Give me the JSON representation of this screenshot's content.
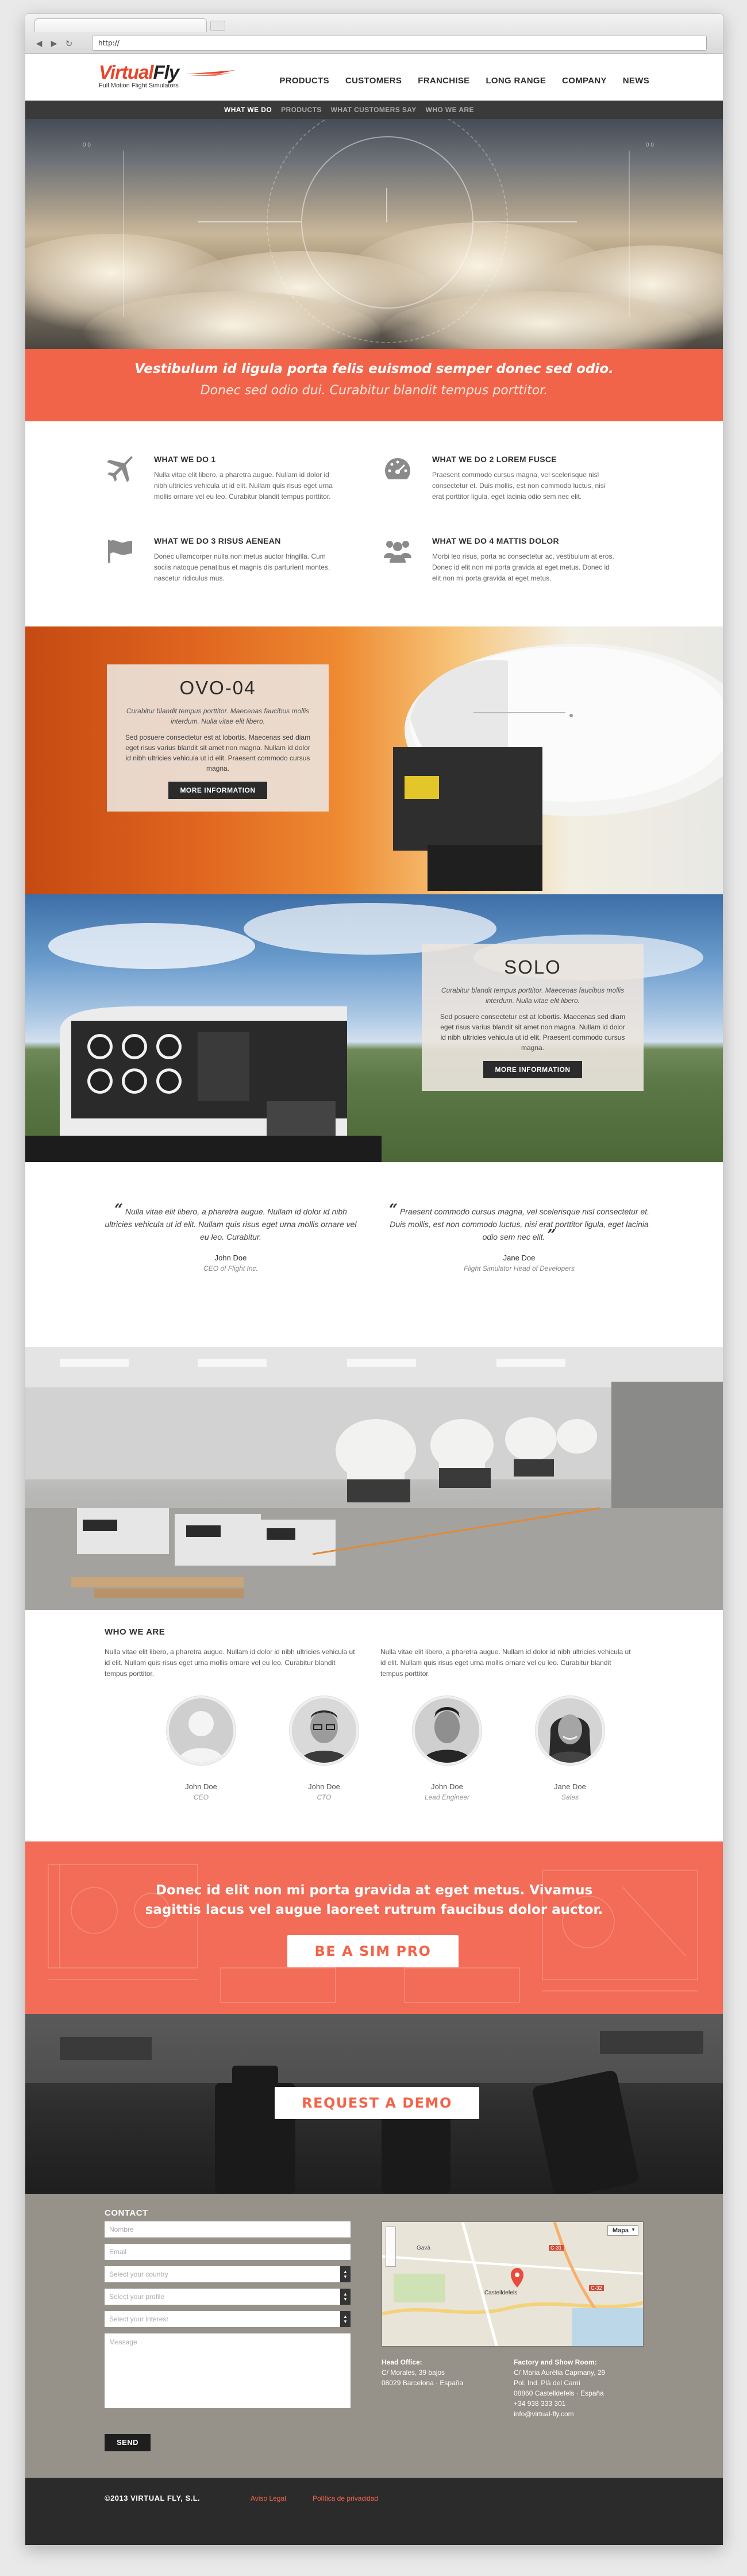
{
  "browser": {
    "url": "http://"
  },
  "brand": {
    "name_part1": "Virtual",
    "name_part2": "Fly",
    "tagline": "Full Motion Flight Simulators"
  },
  "nav": [
    "PRODUCTS",
    "CUSTOMERS",
    "FRANCHISE",
    "LONG RANGE",
    "COMPANY",
    "NEWS"
  ],
  "subnav": [
    {
      "label": "WHAT WE DO",
      "active": true
    },
    {
      "label": "PRODUCTS",
      "active": false
    },
    {
      "label": "WHAT CUSTOMERS SAY",
      "active": false
    },
    {
      "label": "WHO WE ARE",
      "active": false
    }
  ],
  "hero": {
    "headline": "Vestibulum id ligula porta felis euismod semper donec sed odio.",
    "subline": "Donec sed odio dui. Curabitur blandit tempus porttitor."
  },
  "what_we_do": [
    {
      "icon": "airplane-icon",
      "title": "WHAT WE DO 1",
      "text": "Nulla vitae elit libero, a pharetra augue. Nullam id dolor id nibh ultricies vehicula ut id elit. Nullam quis risus eget urna mollis ornare vel eu leo. Curabitur blandit tempus porttitor."
    },
    {
      "icon": "gauge-icon",
      "title": "WHAT WE DO 2 LOREM FUSCE",
      "text": "Praesent commodo cursus magna, vel scelerisque nisl consectetur et. Duis mollis, est non commodo luctus, nisi erat porttitor ligula, eget lacinia odio sem nec elit."
    },
    {
      "icon": "flag-icon",
      "title": "WHAT WE DO 3 RISUS AENEAN",
      "text": "Donec ullamcorper nulla non metus auctor fringilla. Cum sociis natoque penatibus et magnis dis parturient montes, nascetur ridiculus mus."
    },
    {
      "icon": "people-icon",
      "title": "WHAT WE DO 4 MATTIS DOLOR",
      "text": "Morbi leo risus, porta ac consectetur ac, vestibulum at eros. Donec id elit non mi porta gravida at eget metus. Donec id elit non mi porta gravida at eget metus."
    }
  ],
  "products": {
    "ovo": {
      "title": "OVO-04",
      "quote": "Curabitur blandit tempus porttitor. Maecenas faucibus mollis interdum. Nulla vitae elit libero.",
      "text": "Sed posuere consectetur est at lobortis. Maecenas sed diam eget risus varius blandit sit amet non magna. Nullam id dolor id nibh ultricies vehicula ut id elit. Praesent commodo cursus magna.",
      "button": "MORE INFORMATION"
    },
    "solo": {
      "title": "SOLO",
      "quote": "Curabitur blandit tempus porttitor. Maecenas faucibus mollis interdum. Nulla vitae elit libero.",
      "text": "Sed posuere consectetur est at lobortis. Maecenas sed diam eget risus varius blandit sit amet non magna. Nullam id dolor id nibh ultricies vehicula ut id elit. Praesent commodo cursus magna.",
      "button": "MORE INFORMATION"
    }
  },
  "testimonials": [
    {
      "quote": "Nulla vitae elit libero, a pharetra augue. Nullam id dolor id nibh ultricies vehicula ut id elit. Nullam quis risus eget urna mollis ornare vel eu leo. Curabitur.",
      "name": "John Doe",
      "role": "CEO of Flight Inc."
    },
    {
      "quote": "Praesent commodo cursus magna, vel scelerisque nisl consectetur et. Duis mollis, est non commodo luctus, nisi erat porttitor ligula, eget lacinia odio sem nec elit.",
      "name": "Jane Doe",
      "role": "Flight Simulator Head of Developers"
    }
  ],
  "who_we_are": {
    "title": "WHO WE ARE",
    "col1": "Nulla vitae elit libero, a pharetra augue. Nullam id dolor id nibh ultricies vehicula ut id elit. Nullam quis risus eget urna mollis ornare vel eu leo. Curabitur blandit tempus porttitor.",
    "col2": "Nulla vitae elit libero, a pharetra augue. Nullam id dolor id nibh ultricies vehicula ut id elit. Nullam quis risus eget urna mollis ornare vel eu leo. Curabitur blandit tempus porttitor.",
    "team": [
      {
        "name": "John Doe",
        "role": "CEO"
      },
      {
        "name": "John Doe",
        "role": "CTO"
      },
      {
        "name": "John Doe",
        "role": "Lead Engineer"
      },
      {
        "name": "Jane Doe",
        "role": "Sales"
      }
    ]
  },
  "simpro": {
    "text": "Donec id elit non mi porta gravida at eget metus. Vivamus sagittis lacus vel augue laoreet rutrum faucibus dolor auctor.",
    "button": "BE A SIM PRO"
  },
  "demo": {
    "button": "REQUEST A DEMO"
  },
  "contact": {
    "title": "CONTACT",
    "placeholders": {
      "name": "Nombre",
      "email": "Email",
      "country": "Select your country",
      "profile": "Select your profile",
      "interest": "Select your interest",
      "message": "Message"
    },
    "send": "SEND",
    "map": {
      "type_label": "Mapa",
      "place": "Castelldefels",
      "labels": [
        "C-31",
        "C-32",
        "Gavà",
        "Castelldefels"
      ]
    },
    "head_office": {
      "label": "Head Office:",
      "lines": [
        "C/ Morales, 39 bajos",
        "08029 Barcelona · España"
      ]
    },
    "factory": {
      "label": "Factory and Show Room:",
      "lines": [
        "C/ Maria Aurèlia Capmany, 29",
        "Pol. Ind. Plà del Camí",
        "08860 Castelldefels · España",
        "+34 938 333 301",
        "info@virtual-fly.com"
      ]
    }
  },
  "footer": {
    "copyright": "©2013 VIRTUAL FLY, S.L.",
    "links": [
      "Aviso Legal",
      "Política de privacidad"
    ]
  },
  "colors": {
    "accent": "#f26449",
    "dark": "#2b2b2b",
    "contact_bg": "#969189"
  }
}
